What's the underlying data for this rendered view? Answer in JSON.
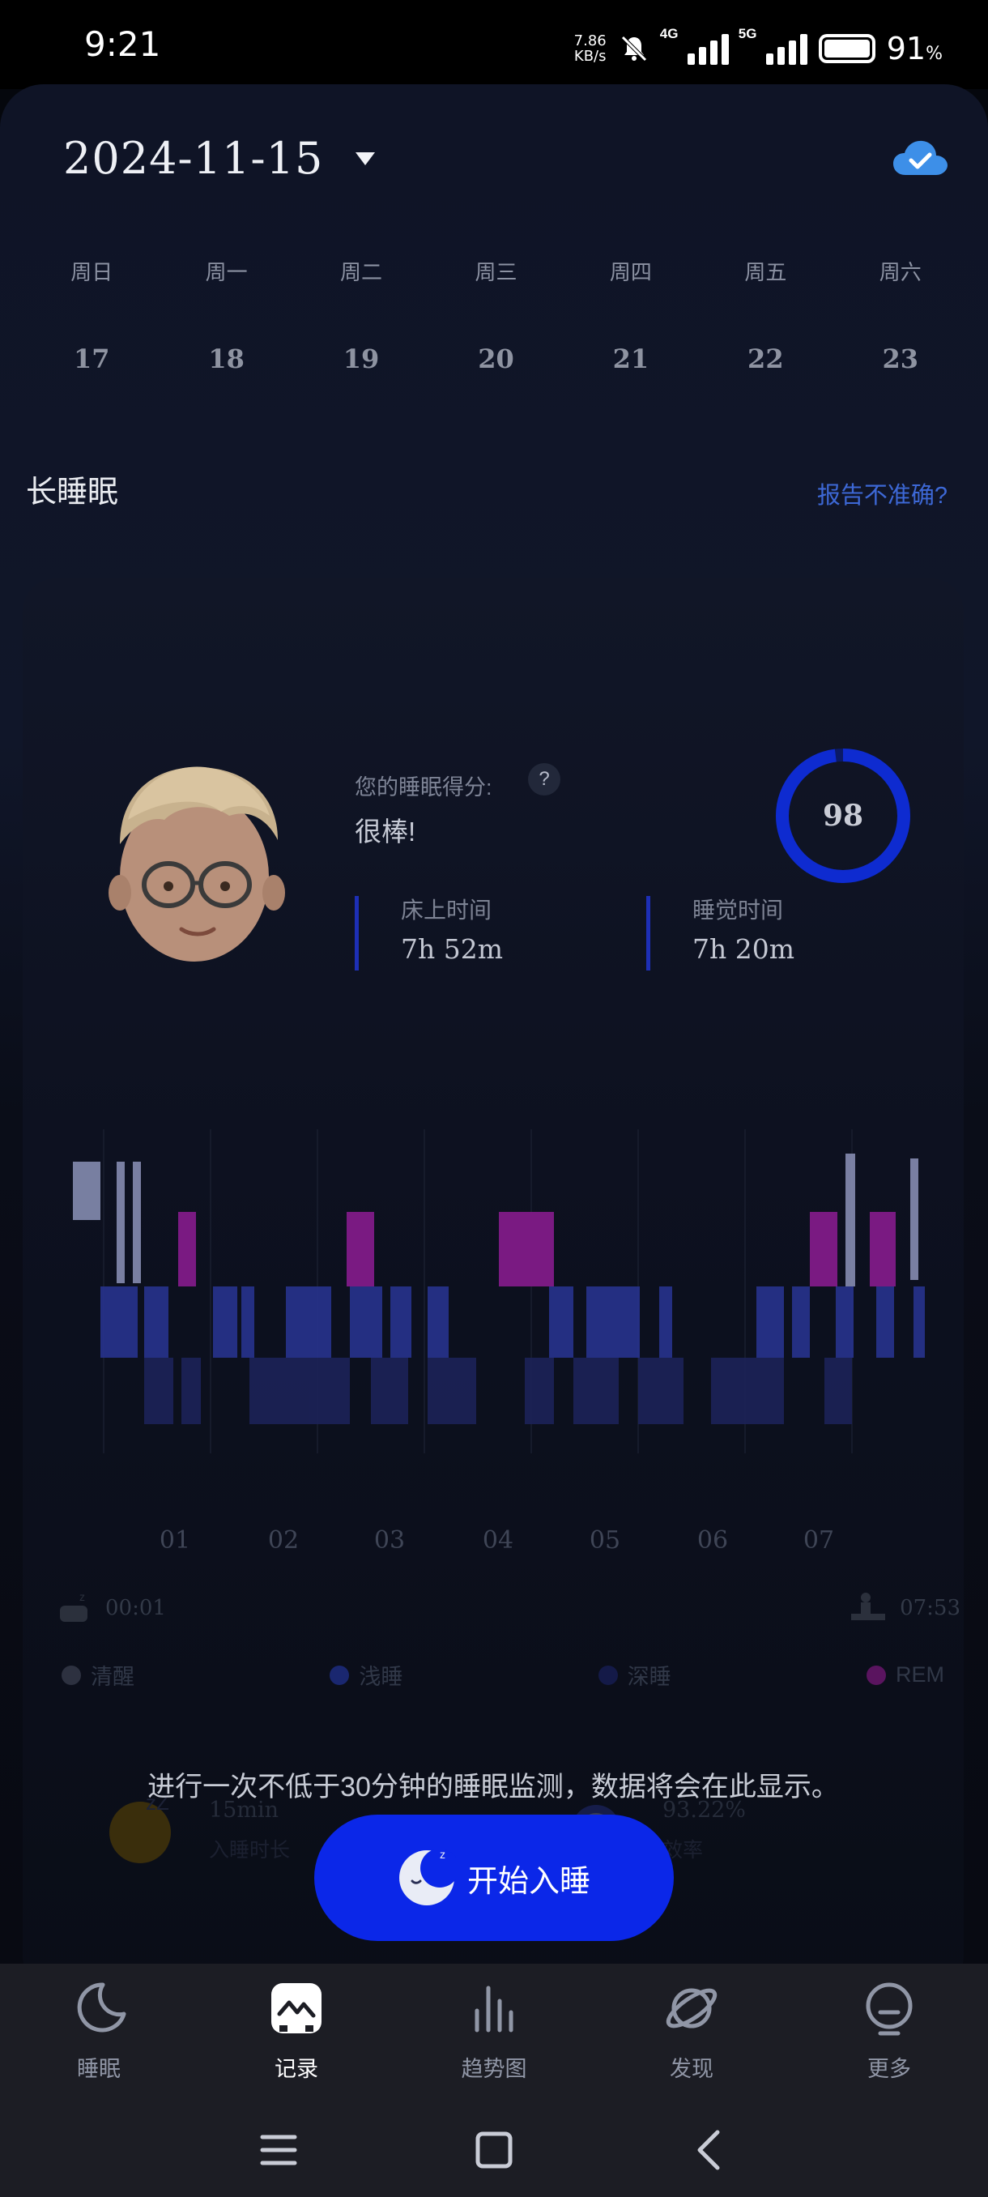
{
  "status_bar": {
    "time": "9:21",
    "net_speed_value": "7.86",
    "net_speed_unit": "KB/s",
    "signal_1": "4G",
    "signal_2": "5G",
    "battery_percent": "91",
    "battery_unit": "%"
  },
  "header": {
    "date": "2024-11-15"
  },
  "calendar": {
    "weekdays": [
      "周日",
      "周一",
      "周二",
      "周三",
      "周四",
      "周五",
      "周六"
    ],
    "days": [
      "17",
      "18",
      "19",
      "20",
      "21",
      "22",
      "23"
    ]
  },
  "section": {
    "title": "长睡眠",
    "report_link": "报告不准确?"
  },
  "summary": {
    "score_label": "您的睡眠得分:",
    "help": "?",
    "score_word": "很棒!",
    "score": "98",
    "score_fraction": 0.98,
    "bed_time_label": "床上时间",
    "bed_time_value": "7h 52m",
    "sleep_time_label": "睡觉时间",
    "sleep_time_value": "7h 20m"
  },
  "chart": {
    "hours": [
      "01",
      "02",
      "03",
      "04",
      "05",
      "06",
      "07"
    ],
    "start_time": "00:01",
    "end_time": "07:53",
    "legend": [
      "清醒",
      "浅睡",
      "深睡",
      "REM"
    ],
    "colors": {
      "awake": "#9aa2c8",
      "light": "#2d3a9c",
      "deep": "#1f2670",
      "rem": "#8a1a8f"
    }
  },
  "empty_message": "进行一次不低于30分钟的睡眠监测，数据将会在此显示。",
  "mini_stats": [
    {
      "value": "15min",
      "label": "入睡时长"
    },
    {
      "value": "93.22%",
      "label": "效率"
    }
  ],
  "start_button": "开始入睡",
  "bottom_nav": [
    {
      "label": "睡眠",
      "icon": "moon-icon"
    },
    {
      "label": "记录",
      "icon": "record-icon"
    },
    {
      "label": "趋势图",
      "icon": "trend-icon"
    },
    {
      "label": "发现",
      "icon": "planet-icon"
    },
    {
      "label": "更多",
      "icon": "more-icon"
    }
  ],
  "active_nav": "记录"
}
